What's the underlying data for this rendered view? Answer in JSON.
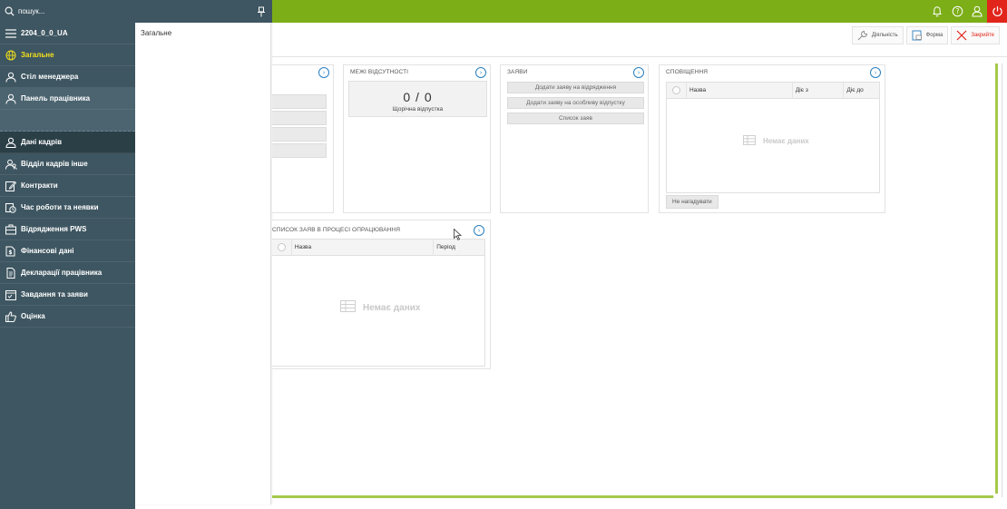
{
  "topbar": {
    "search_placeholder": "пошук...",
    "accent_color": "#7cae18",
    "power_color": "#e1251b"
  },
  "sidebar": {
    "items": [
      {
        "label": "2204_0_0_UA",
        "icon": "menu-icon"
      },
      {
        "label": "Загальне",
        "icon": "globe-icon",
        "active": true
      },
      {
        "label": "Стіл менеджера",
        "icon": "person-icon"
      },
      {
        "label": "Панель працівника",
        "icon": "person-icon"
      },
      {
        "label": "Дані кадрів",
        "icon": "person-icon"
      },
      {
        "label": "Відділ кадрів інше",
        "icon": "people-icon"
      },
      {
        "label": "Контракти",
        "icon": "edit-icon"
      },
      {
        "label": "Час роботи та неявки",
        "icon": "clock-icon"
      },
      {
        "label": "Відрядження PWS",
        "icon": "briefcase-icon"
      },
      {
        "label": "Фінансові дані",
        "icon": "finance-icon"
      },
      {
        "label": "Декларації працівника",
        "icon": "document-icon"
      },
      {
        "label": "Завдання та заяви",
        "icon": "calendar-icon"
      },
      {
        "label": "Оцінка",
        "icon": "thumbs-up-icon"
      }
    ]
  },
  "flyout": {
    "items": [
      "Загальне"
    ]
  },
  "header": {
    "buttons": [
      {
        "label": "Діяльність",
        "icon": "wrench-icon"
      },
      {
        "label": "Форма",
        "icon": "form-icon"
      },
      {
        "label": "Закрийте",
        "icon": "close-icon"
      }
    ]
  },
  "widgets": {
    "absence_limits": {
      "title": "МЕЖІ ВІДСУТНОСТІ",
      "value": "0 / 0",
      "subtitle": "Щорічна відпустка"
    },
    "requests": {
      "title": "ЗАЯВИ",
      "buttons": [
        "Додати заяву на відрядження",
        "Додати заяву на особливу відпустку",
        "Список заяв"
      ]
    },
    "notifications": {
      "title": "СПОВІЩЕННЯ",
      "columns": [
        "Назва",
        "Діє з",
        "Діє до"
      ],
      "empty_text": "Немає даних",
      "remind_button": "Не нагадувати"
    },
    "pending_requests": {
      "title": "СПИСОК ЗАЯВ В ПРОЦЕСІ ОПРАЦЮВАННЯ",
      "columns": [
        "Назва",
        "Період"
      ],
      "empty_text": "Немає даних"
    }
  }
}
